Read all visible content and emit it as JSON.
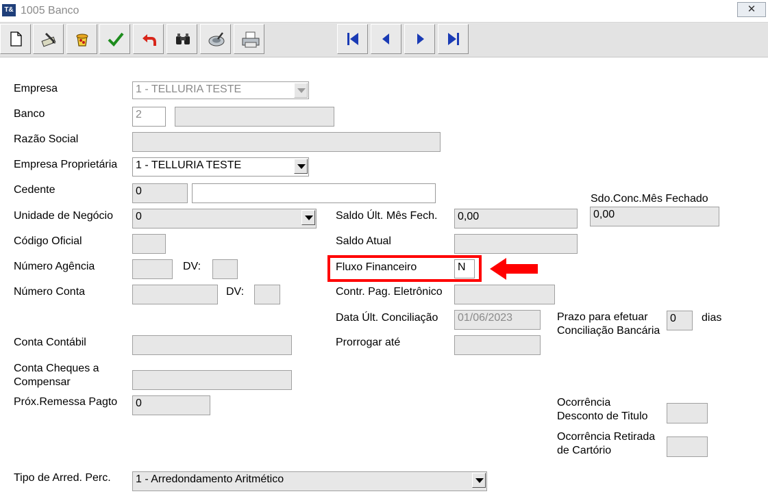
{
  "window": {
    "title": "1005 Banco",
    "app_icon_label": "T&",
    "close_label": "✕"
  },
  "toolbar": {
    "buttons": [
      "new-document-icon",
      "edit-icon",
      "delete-icon",
      "confirm-check-icon",
      "undo-icon",
      "search-binoculars-icon",
      "filter-icon",
      "print-icon"
    ],
    "nav": [
      "first-record-icon",
      "previous-record-icon",
      "next-record-icon",
      "last-record-icon"
    ]
  },
  "form": {
    "empresa": {
      "label": "Empresa",
      "value": "1 - TELLURIA TESTE"
    },
    "banco": {
      "label": "Banco",
      "value": "2",
      "name_value": ""
    },
    "razao_social": {
      "label": "Razão Social",
      "value": ""
    },
    "empresa_proprietaria": {
      "label": "Empresa Proprietária",
      "value": "1 - TELLURIA TESTE"
    },
    "cedente": {
      "label": "Cedente",
      "value": "0",
      "extra_value": ""
    },
    "unidade_negocio": {
      "label": "Unidade de Negócio",
      "value": "0"
    },
    "codigo_oficial": {
      "label": "Código Oficial",
      "value": ""
    },
    "numero_agencia": {
      "label": "Número Agência",
      "value": "",
      "dv_label": "DV:",
      "dv_value": ""
    },
    "numero_conta": {
      "label": "Número Conta",
      "value": "",
      "dv_label": "DV:",
      "dv_value": ""
    },
    "conta_contabil": {
      "label": "Conta Contábil",
      "value": ""
    },
    "conta_cheques": {
      "label_line1": "Conta Cheques a",
      "label_line2": "Compensar",
      "value": ""
    },
    "prox_remessa": {
      "label": "Próx.Remessa Pagto",
      "value": "0"
    },
    "saldo_ult_mes": {
      "label": "Saldo Últ. Mês Fech.",
      "value": "0,00"
    },
    "saldo_atual": {
      "label": "Saldo Atual",
      "value": ""
    },
    "fluxo_financeiro": {
      "label": "Fluxo Financeiro",
      "value": "N"
    },
    "contr_pag": {
      "label": "Contr. Pag. Eletrônico",
      "value": ""
    },
    "data_ult_conc": {
      "label": "Data Últ. Conciliação",
      "value": "01/06/2023"
    },
    "prorrogar": {
      "label": "Prorrogar até",
      "value": ""
    },
    "sdo_conc": {
      "label": "Sdo.Conc.Mês Fechado",
      "value": "0,00"
    },
    "prazo": {
      "label_line1": "Prazo para efetuar",
      "label_line2": "Conciliação Bancária",
      "value": "0",
      "unit": "dias"
    },
    "ocorrencia_desconto": {
      "label_line1": "Ocorrência",
      "label_line2": "Desconto de Titulo",
      "value": ""
    },
    "ocorrencia_retirada": {
      "label_line1": "Ocorrência Retirada",
      "label_line2": "de Cartório",
      "value": ""
    },
    "tipo_arred": {
      "label": "Tipo de Arred. Perc.",
      "value": "1 - Arredondamento Aritmético"
    }
  },
  "colors": {
    "highlight": "#ff0000",
    "nav_icon": "#1a3bb5"
  }
}
